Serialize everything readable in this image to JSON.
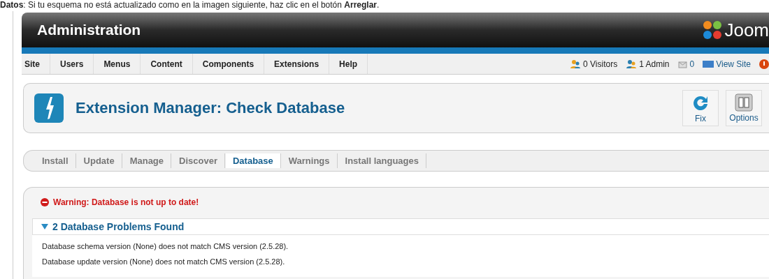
{
  "intro": "**Datos**: Si tu esquema no está actualizado como en la imagen siguiente, haz clic en el botón **Arreglar**.",
  "header": {
    "title": "Administration",
    "logo_text": "Joom"
  },
  "menu": [
    {
      "label": "Site"
    },
    {
      "label": "Users"
    },
    {
      "label": "Menus"
    },
    {
      "label": "Content"
    },
    {
      "label": "Components"
    },
    {
      "label": "Extensions"
    },
    {
      "label": "Help"
    }
  ],
  "status": [
    {
      "kind": "visitors",
      "label": "0 Visitors"
    },
    {
      "kind": "admins",
      "label": "1 Admin"
    },
    {
      "kind": "messages",
      "label": "0"
    },
    {
      "kind": "site",
      "label": "View Site"
    },
    {
      "kind": "logout"
    }
  ],
  "page_title": "Extension Manager: Check Database",
  "toolbar": [
    {
      "kind": "fix",
      "label": "Fix"
    },
    {
      "kind": "options",
      "label": "Options"
    }
  ],
  "subnav": [
    {
      "label": "Install",
      "selected": false
    },
    {
      "label": "Update",
      "selected": false
    },
    {
      "label": "Manage",
      "selected": false
    },
    {
      "label": "Discover",
      "selected": false
    },
    {
      "label": "Database",
      "selected": true
    },
    {
      "label": "Warnings",
      "selected": false
    },
    {
      "label": "Install languages",
      "selected": false
    }
  ],
  "warning": "Warning: Database is not up to date!",
  "problems": {
    "title": "2 Database Problems Found",
    "expanded": true,
    "items": [
      "Database schema version (None) does not match CMS version (2.5.28).",
      "Database update version (None) does not match CMS version (2.5.28)."
    ]
  }
}
